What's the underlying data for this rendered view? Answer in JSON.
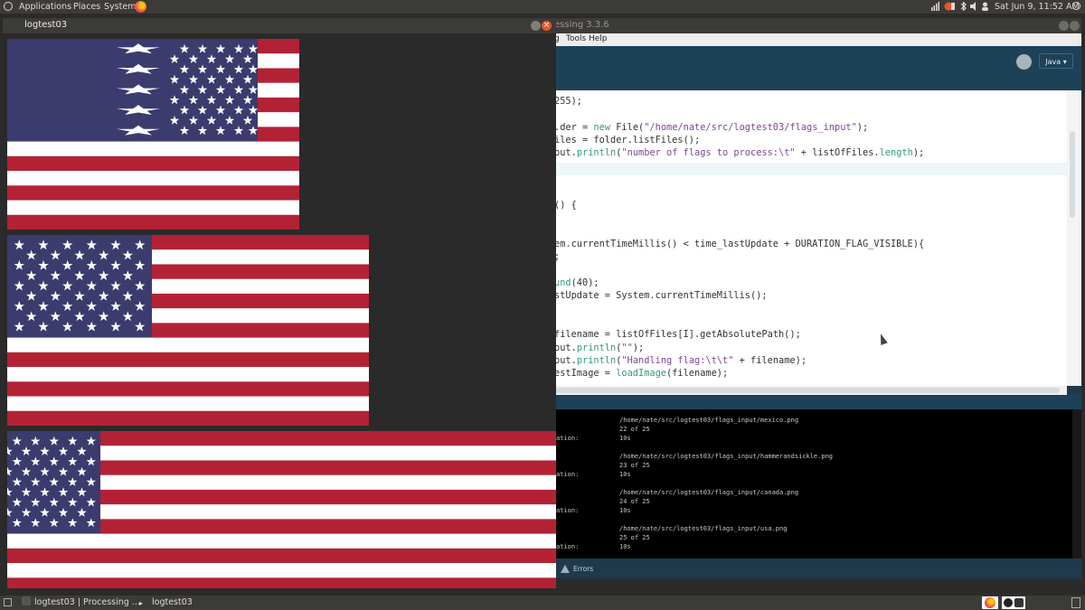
{
  "top_panel": {
    "applications": "Applications",
    "places": "Places",
    "system": "System",
    "clock": "Sat Jun 9, 11:52 AM"
  },
  "bottom_panel": {
    "task1": "logtest03 | Processing ...",
    "task2": "logtest03"
  },
  "sketch_window": {
    "title": "logtest03"
  },
  "ide": {
    "title": "essing 3.3.6",
    "menu": [
      "g",
      "Tools",
      "Help"
    ],
    "mode": "Java ▾",
    "code_lines": [
      "255);",
      "",
      ".der = new File(\"/home/nate/src/logtest03/flags_input\");",
      "iles = folder.listFiles();",
      "out.println(\"number of flags to process:\\t\" + listOfFiles.length);",
      "",
      "",
      "",
      "() {",
      "",
      "",
      "em.currentTimeMillis() < time_lastUpdate + DURATION_FLAG_VISIBLE){",
      ";",
      "",
      "und(40);",
      "stUpdate = System.currentTimeMillis();",
      "",
      "",
      "filename = listOfFiles[I].getAbsolutePath();",
      "out.println(\"\");",
      "out.println(\"Handling flag:\\t\\t\" + filename);",
      "estImage = loadImage(filename);"
    ],
    "console_entries": [
      {
        "path": "/home/nate/src/logtest03/flags_input/mexico.png",
        "count": "22 of 25",
        "label": "ation:",
        "duration": "10s"
      },
      {
        "path": "/home/nate/src/logtest03/flags_input/hammerandsickle.png",
        "count": "23 of 25",
        "label": "ation:",
        "duration": "10s"
      },
      {
        "path": "/home/nate/src/logtest03/flags_input/canada.png",
        "count": "24 of 25",
        "label": "ation:",
        "duration": "10s"
      },
      {
        "path": "/home/nate/src/logtest03/flags_input/usa.png",
        "count": "25 of 25",
        "label": "ation:",
        "duration": "10s"
      }
    ],
    "errors_tab": "Errors"
  },
  "colors": {
    "flag_red": "#b22234",
    "flag_blue": "#3c3b6e",
    "ubuntu_panel": "#3c3b37",
    "ide_blue": "#1d4258"
  }
}
